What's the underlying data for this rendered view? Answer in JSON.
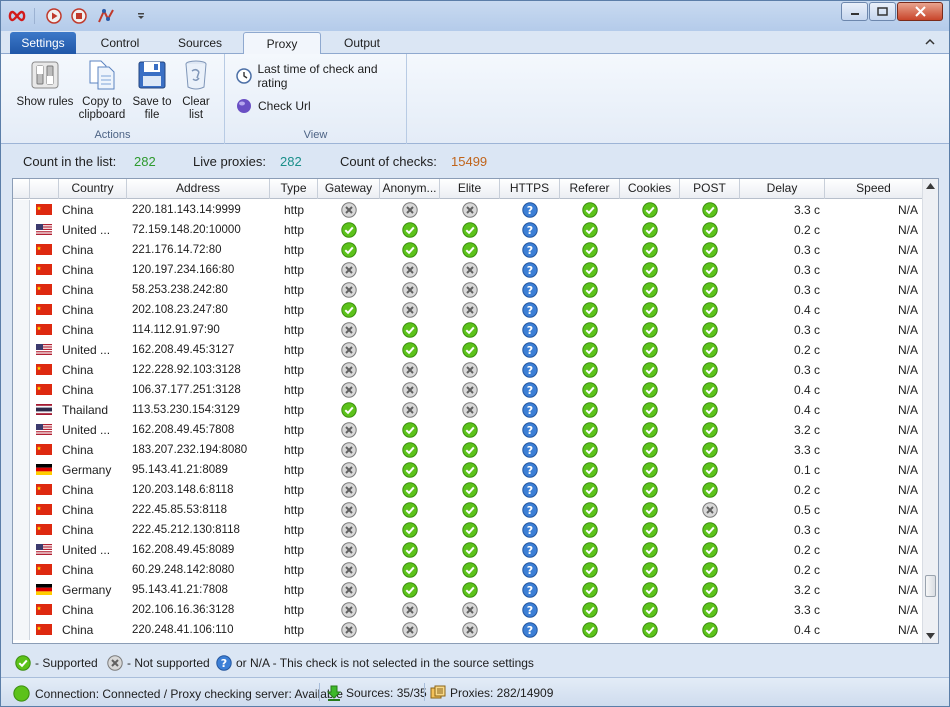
{
  "colors": {
    "green": "#2e9a2e",
    "teal": "#1a8f8a",
    "orange": "#c0641a",
    "supported": "#5cc21a",
    "not_supported": "#8a8a8a",
    "unknown": "#3c7fd6"
  },
  "tabs": [
    "Settings",
    "Control",
    "Sources",
    "Proxy",
    "Output"
  ],
  "ribbon": {
    "actions": {
      "show_rules": "Show rules",
      "copy_to_clipboard": "Copy to clipboard",
      "save_to_file": "Save to file",
      "clear_list": "Clear list",
      "label": "Actions"
    },
    "view": {
      "last_check": "Last time of check and rating",
      "check_url": "Check Url",
      "label": "View"
    }
  },
  "stats": {
    "count_label": "Count in the list:",
    "count": "282",
    "live_label": "Live proxies:",
    "live": "282",
    "checks_label": "Count of checks:",
    "checks": "15499"
  },
  "columns": [
    "Country",
    "Address",
    "Type",
    "Gateway",
    "Anonym...",
    "Elite",
    "HTTPS",
    "Referer",
    "Cookies",
    "POST",
    "Delay",
    "Speed"
  ],
  "rows": [
    {
      "flag": "cn",
      "country": "China",
      "address": "220.181.143.14:9999",
      "type": "http",
      "gateway": "n",
      "anon": "n",
      "elite": "n",
      "https": "q",
      "referer": "y",
      "cookies": "y",
      "post": "y",
      "delay": "3.3 c",
      "speed": "N/A"
    },
    {
      "flag": "us",
      "country": "United ...",
      "address": "72.159.148.20:10000",
      "type": "http",
      "gateway": "y",
      "anon": "y",
      "elite": "y",
      "https": "q",
      "referer": "y",
      "cookies": "y",
      "post": "y",
      "delay": "0.2 c",
      "speed": "N/A"
    },
    {
      "flag": "cn",
      "country": "China",
      "address": "221.176.14.72:80",
      "type": "http",
      "gateway": "y",
      "anon": "y",
      "elite": "y",
      "https": "q",
      "referer": "y",
      "cookies": "y",
      "post": "y",
      "delay": "0.3 c",
      "speed": "N/A"
    },
    {
      "flag": "cn",
      "country": "China",
      "address": "120.197.234.166:80",
      "type": "http",
      "gateway": "n",
      "anon": "n",
      "elite": "n",
      "https": "q",
      "referer": "y",
      "cookies": "y",
      "post": "y",
      "delay": "0.3 c",
      "speed": "N/A"
    },
    {
      "flag": "cn",
      "country": "China",
      "address": "58.253.238.242:80",
      "type": "http",
      "gateway": "n",
      "anon": "n",
      "elite": "n",
      "https": "q",
      "referer": "y",
      "cookies": "y",
      "post": "y",
      "delay": "0.3 c",
      "speed": "N/A"
    },
    {
      "flag": "cn",
      "country": "China",
      "address": "202.108.23.247:80",
      "type": "http",
      "gateway": "y",
      "anon": "n",
      "elite": "n",
      "https": "q",
      "referer": "y",
      "cookies": "y",
      "post": "y",
      "delay": "0.4 c",
      "speed": "N/A"
    },
    {
      "flag": "cn",
      "country": "China",
      "address": "114.112.91.97:90",
      "type": "http",
      "gateway": "n",
      "anon": "y",
      "elite": "y",
      "https": "q",
      "referer": "y",
      "cookies": "y",
      "post": "y",
      "delay": "0.3 c",
      "speed": "N/A"
    },
    {
      "flag": "us",
      "country": "United ...",
      "address": "162.208.49.45:3127",
      "type": "http",
      "gateway": "n",
      "anon": "y",
      "elite": "y",
      "https": "q",
      "referer": "y",
      "cookies": "y",
      "post": "y",
      "delay": "0.2 c",
      "speed": "N/A"
    },
    {
      "flag": "cn",
      "country": "China",
      "address": "122.228.92.103:3128",
      "type": "http",
      "gateway": "n",
      "anon": "n",
      "elite": "n",
      "https": "q",
      "referer": "y",
      "cookies": "y",
      "post": "y",
      "delay": "0.3 c",
      "speed": "N/A"
    },
    {
      "flag": "cn",
      "country": "China",
      "address": "106.37.177.251:3128",
      "type": "http",
      "gateway": "n",
      "anon": "n",
      "elite": "n",
      "https": "q",
      "referer": "y",
      "cookies": "y",
      "post": "y",
      "delay": "0.4 c",
      "speed": "N/A"
    },
    {
      "flag": "th",
      "country": "Thailand",
      "address": "113.53.230.154:3129",
      "type": "http",
      "gateway": "y",
      "anon": "n",
      "elite": "n",
      "https": "q",
      "referer": "y",
      "cookies": "y",
      "post": "y",
      "delay": "0.4 c",
      "speed": "N/A"
    },
    {
      "flag": "us",
      "country": "United ...",
      "address": "162.208.49.45:7808",
      "type": "http",
      "gateway": "n",
      "anon": "y",
      "elite": "y",
      "https": "q",
      "referer": "y",
      "cookies": "y",
      "post": "y",
      "delay": "3.2 c",
      "speed": "N/A"
    },
    {
      "flag": "cn",
      "country": "China",
      "address": "183.207.232.194:8080",
      "type": "http",
      "gateway": "n",
      "anon": "y",
      "elite": "y",
      "https": "q",
      "referer": "y",
      "cookies": "y",
      "post": "y",
      "delay": "3.3 c",
      "speed": "N/A"
    },
    {
      "flag": "de",
      "country": "Germany",
      "address": "95.143.41.21:8089",
      "type": "http",
      "gateway": "n",
      "anon": "y",
      "elite": "y",
      "https": "q",
      "referer": "y",
      "cookies": "y",
      "post": "y",
      "delay": "0.1 c",
      "speed": "N/A"
    },
    {
      "flag": "cn",
      "country": "China",
      "address": "120.203.148.6:8118",
      "type": "http",
      "gateway": "n",
      "anon": "y",
      "elite": "y",
      "https": "q",
      "referer": "y",
      "cookies": "y",
      "post": "y",
      "delay": "0.2 c",
      "speed": "N/A"
    },
    {
      "flag": "cn",
      "country": "China",
      "address": "222.45.85.53:8118",
      "type": "http",
      "gateway": "n",
      "anon": "y",
      "elite": "y",
      "https": "q",
      "referer": "y",
      "cookies": "y",
      "post": "n",
      "delay": "0.5 c",
      "speed": "N/A"
    },
    {
      "flag": "cn",
      "country": "China",
      "address": "222.45.212.130:8118",
      "type": "http",
      "gateway": "n",
      "anon": "y",
      "elite": "y",
      "https": "q",
      "referer": "y",
      "cookies": "y",
      "post": "y",
      "delay": "0.3 c",
      "speed": "N/A"
    },
    {
      "flag": "us",
      "country": "United ...",
      "address": "162.208.49.45:8089",
      "type": "http",
      "gateway": "n",
      "anon": "y",
      "elite": "y",
      "https": "q",
      "referer": "y",
      "cookies": "y",
      "post": "y",
      "delay": "0.2 c",
      "speed": "N/A"
    },
    {
      "flag": "cn",
      "country": "China",
      "address": "60.29.248.142:8080",
      "type": "http",
      "gateway": "n",
      "anon": "y",
      "elite": "y",
      "https": "q",
      "referer": "y",
      "cookies": "y",
      "post": "y",
      "delay": "0.2 c",
      "speed": "N/A"
    },
    {
      "flag": "de",
      "country": "Germany",
      "address": "95.143.41.21:7808",
      "type": "http",
      "gateway": "n",
      "anon": "y",
      "elite": "y",
      "https": "q",
      "referer": "y",
      "cookies": "y",
      "post": "y",
      "delay": "3.2 c",
      "speed": "N/A"
    },
    {
      "flag": "cn",
      "country": "China",
      "address": "202.106.16.36:3128",
      "type": "http",
      "gateway": "n",
      "anon": "n",
      "elite": "n",
      "https": "q",
      "referer": "y",
      "cookies": "y",
      "post": "y",
      "delay": "3.3 c",
      "speed": "N/A"
    },
    {
      "flag": "cn",
      "country": "China",
      "address": "220.248.41.106:110",
      "type": "http",
      "gateway": "n",
      "anon": "n",
      "elite": "n",
      "https": "q",
      "referer": "y",
      "cookies": "y",
      "post": "y",
      "delay": "0.4 c",
      "speed": "N/A"
    }
  ],
  "legend": {
    "supported": "- Supported",
    "not_supported": "- Not supported",
    "unknown": "or N/A - This check is not selected in the source settings"
  },
  "status": {
    "connection": "Connection: Connected / Proxy checking server: Available",
    "sources": "Sources: 35/35",
    "proxies": "Proxies: 282/14909"
  }
}
